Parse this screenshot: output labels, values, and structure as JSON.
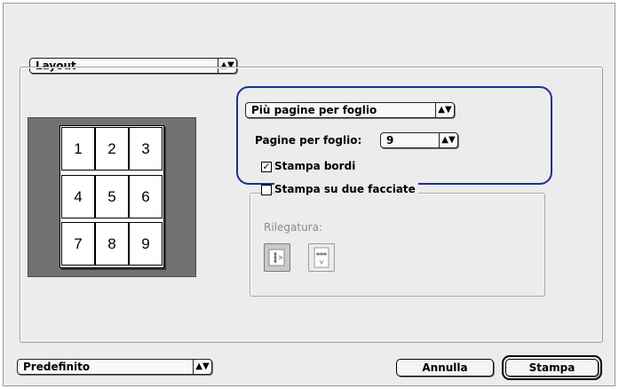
{
  "panel_select": {
    "value": "Layout"
  },
  "layout": {
    "pages_mode_select": {
      "value": "Più pagine per foglio"
    },
    "pages_per_sheet_label": "Pagine per foglio:",
    "pages_per_sheet_select": {
      "value": "9"
    },
    "print_borders": {
      "label": "Stampa bordi",
      "checked": true
    },
    "preview_pages": [
      "1",
      "2",
      "3",
      "4",
      "5",
      "6",
      "7",
      "8",
      "9"
    ]
  },
  "duplex": {
    "label": "Stampa su due facciate",
    "checked": false,
    "binding_label": "Rilegatura:",
    "binding_options": [
      {
        "icon": "book-binding-left-icon",
        "selected": true
      },
      {
        "icon": "tablet-binding-top-icon",
        "selected": false
      }
    ]
  },
  "footer": {
    "preset_select": {
      "value": "Predefinito"
    },
    "cancel_label": "Annulla",
    "print_label": "Stampa"
  },
  "colors": {
    "highlight": "#1f2d8f",
    "dialog_bg": "#ececec",
    "preview_bg": "#727272"
  }
}
